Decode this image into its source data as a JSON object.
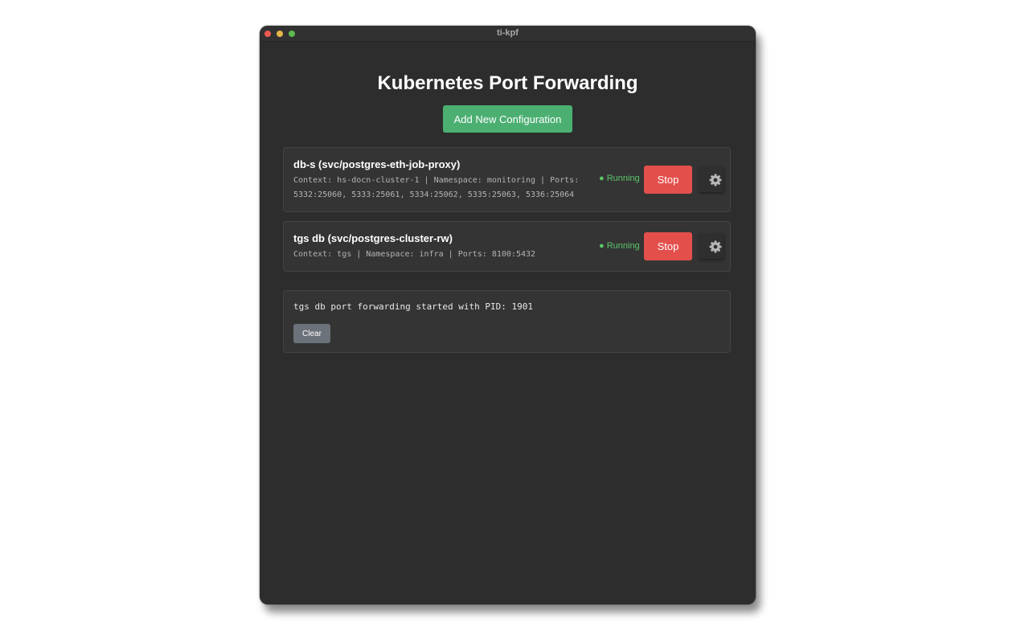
{
  "window": {
    "title": "ti-kpf"
  },
  "header": {
    "title": "Kubernetes Port Forwarding",
    "add_label": "Add New Configuration"
  },
  "configs": [
    {
      "name": "db-s (svc/postgres-eth-job-proxy)",
      "details": "Context: hs-docn-cluster-1 | Namespace: monitoring | Ports: 5332:25060, 5333:25061, 5334:25062, 5335:25063, 5336:25064",
      "status": "● Running",
      "stop_label": "Stop",
      "settings_icon": "gear-icon"
    },
    {
      "name": "tgs db (svc/postgres-cluster-rw)",
      "details": "Context: tgs | Namespace: infra | Ports: 8100:5432",
      "status": "● Running",
      "stop_label": "Stop",
      "settings_icon": "gear-icon"
    }
  ],
  "log": {
    "text": "tgs db port forwarding started with PID: 1901",
    "clear_label": "Clear"
  },
  "colors": {
    "background": "#2d2d2d",
    "card": "#343434",
    "add_button": "#4caf72",
    "stop_button": "#e34f4b",
    "running": "#5cc66a",
    "clear_button": "#6c7279"
  }
}
